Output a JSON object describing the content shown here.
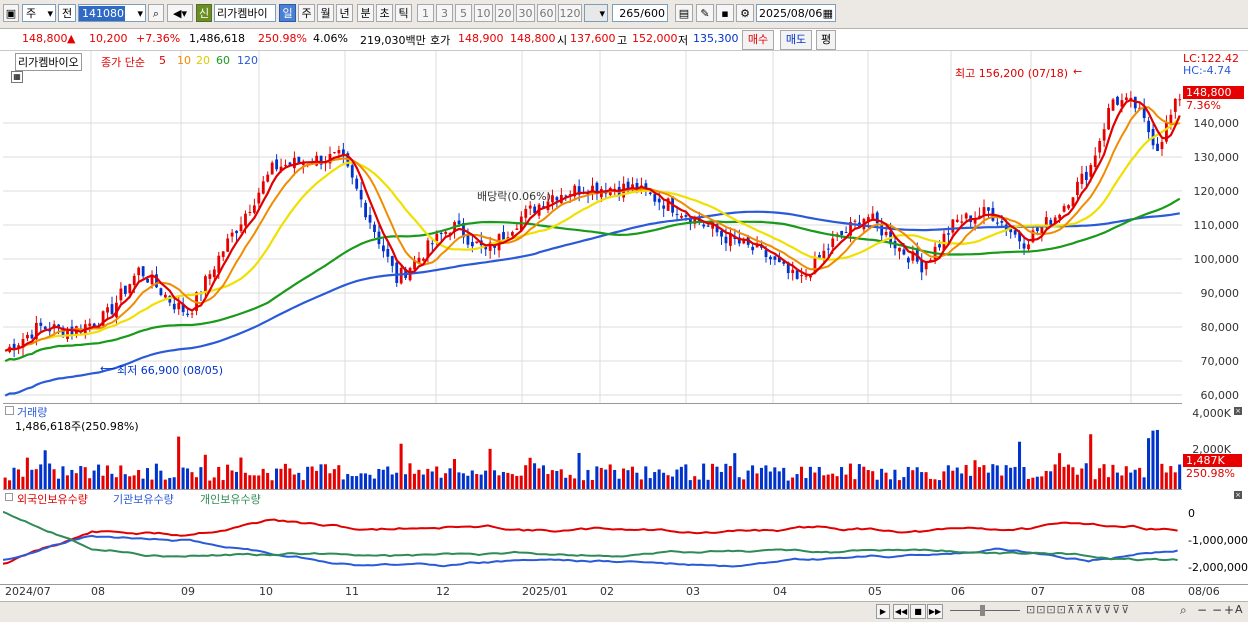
{
  "toolbar": {
    "market": "주",
    "mode": "전",
    "code": "141080",
    "credit_badge": "신",
    "stock_name": "리가켐바이",
    "periods": [
      "일",
      "주",
      "월",
      "년",
      "분",
      "초",
      "틱"
    ],
    "active_period": "일",
    "intervals": [
      "1",
      "3",
      "5",
      "10",
      "20",
      "30",
      "60",
      "120"
    ],
    "count": "265",
    "max_count": "/600",
    "date": "2025/08/06"
  },
  "quote": {
    "price": "148,800",
    "arrow": "▲",
    "change": "10,200",
    "change_pct": "+7.36%",
    "volume": "1,486,618",
    "volume_ratio": "250.98%",
    "turnover": "4.06%",
    "amount": "219,030백만",
    "bid_label": "호가",
    "bid1": "148,900",
    "bid2": "148,800",
    "open_label": "시",
    "open": "137,600",
    "high_label": "고",
    "high": "152,000",
    "low_label": "저",
    "low": "135,300",
    "buy_label": "매수",
    "sell_label": "매도",
    "flat_label": "평"
  },
  "price_pane": {
    "name": "리가켐바이오",
    "ma_title": "종가 단순",
    "ma_periods": [
      "5",
      "10",
      "20",
      "60",
      "120"
    ],
    "high_note": "최고 156,200 (07/18)",
    "low_note": "최저 66,900 (08/05)",
    "dividend_note": "배당락(0.06%)",
    "lc": "LC:122.42",
    "hc": "HC:-4.74",
    "current_price": "148,800",
    "current_pct": "7.36%",
    "y_ticks": [
      "140,000",
      "130,000",
      "120,000",
      "110,000",
      "100,000",
      "90,000",
      "80,000",
      "70,000",
      "60,000"
    ]
  },
  "volume_pane": {
    "title": "거래량",
    "summary": "1,486,618주(250.98%)",
    "y_ticks": [
      "4,000K",
      "2,000K"
    ],
    "current": "1,487K",
    "current_pct": "250.98%"
  },
  "holder_pane": {
    "legend": [
      "외국인보유수량",
      "기관보유수량",
      "개인보유수량"
    ],
    "y_ticks": [
      "0",
      "-1,000,000",
      "-2,000,000"
    ]
  },
  "x_axis": [
    "2024/07",
    "08",
    "09",
    "10",
    "11",
    "12",
    "2025/01",
    "02",
    "03",
    "04",
    "05",
    "06",
    "07",
    "08"
  ],
  "x_right_label": "08/06",
  "colors": {
    "up": "#e60000",
    "down": "#0033cc",
    "ma5": "#e00000",
    "ma10": "#f08c00",
    "ma20": "#f0e000",
    "ma60": "#1a9a1a",
    "ma120": "#2a5ad8",
    "foreign": "#e00000",
    "institution": "#2a5ad8",
    "individual": "#2e8b57"
  }
}
